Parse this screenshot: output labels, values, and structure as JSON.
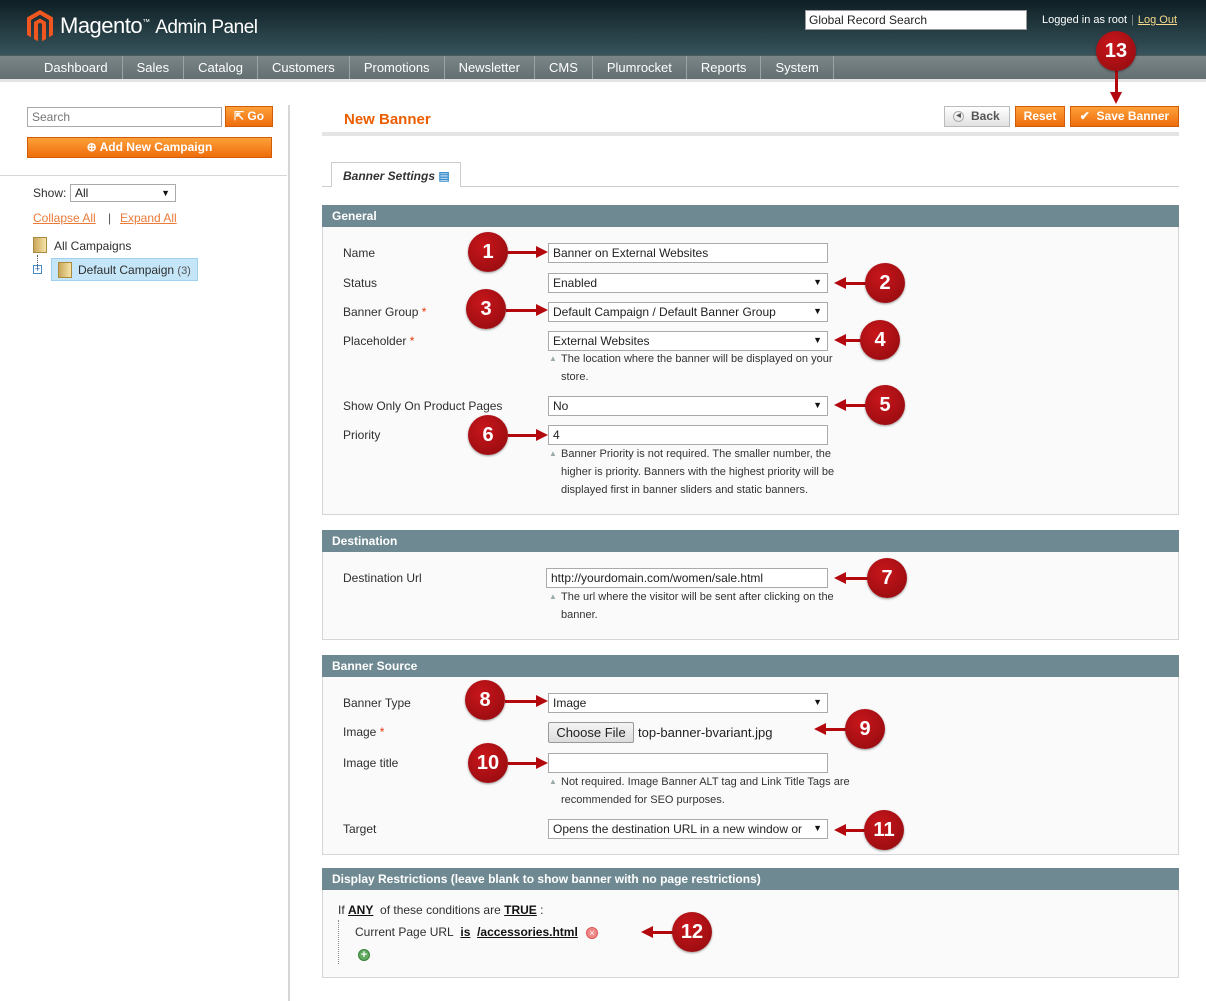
{
  "header": {
    "logo": "Magento",
    "logo_suffix": "Admin Panel",
    "global_search_placeholder": "Global Record Search",
    "logged_in": "Logged in as root",
    "logout": "Log Out"
  },
  "nav": [
    "Dashboard",
    "Sales",
    "Catalog",
    "Customers",
    "Promotions",
    "Newsletter",
    "CMS",
    "Plumrocket",
    "Reports",
    "System"
  ],
  "sidebar": {
    "search_placeholder": "Search",
    "go": "Go",
    "add_campaign": "Add New Campaign",
    "show_label": "Show:",
    "show_value": "All",
    "collapse_all": "Collapse All",
    "expand_all": "Expand All",
    "tree": {
      "root": "All Campaigns",
      "child": "Default Campaign",
      "child_count": "(3)"
    }
  },
  "page": {
    "title": "New Banner",
    "back": "Back",
    "reset": "Reset",
    "save": "Save Banner",
    "tab": "Banner Settings"
  },
  "general": {
    "title": "General",
    "name_label": "Name",
    "name_value": "Banner on External Websites",
    "status_label": "Status",
    "status_value": "Enabled",
    "group_label": "Banner Group",
    "group_value": "Default Campaign / Default Banner Group",
    "placeholder_label": "Placeholder",
    "placeholder_value": "External Websites",
    "placeholder_note": "The location where the banner will be displayed on your store.",
    "product_label": "Show Only On Product Pages",
    "product_value": "No",
    "priority_label": "Priority",
    "priority_value": "4",
    "priority_note": "Banner Priority is not required. The smaller number, the higher is priority. Banners with the highest priority will be displayed first in banner sliders and static banners."
  },
  "destination": {
    "title": "Destination",
    "url_label": "Destination Url",
    "url_value": "http://yourdomain.com/women/sale.html",
    "url_note": "The url where the visitor will be sent after clicking on the banner."
  },
  "source": {
    "title": "Banner Source",
    "type_label": "Banner Type",
    "type_value": "Image",
    "image_label": "Image",
    "choose_file": "Choose File",
    "file_name": "top-banner-bvariant.jpg",
    "image_title_label": "Image title",
    "image_title_value": "",
    "image_title_note": "Not required. Image Banner ALT tag and Link Title Tags are recommended for SEO purposes.",
    "target_label": "Target",
    "target_value": "Opens the destination URL in a new window or"
  },
  "restrictions": {
    "title": "Display Restrictions (leave blank to show banner with no page restrictions)",
    "if": "If",
    "any": "ANY",
    "of_these": "of these conditions are",
    "true": "TRUE",
    "colon": ":",
    "cond_attr": "Current Page URL",
    "cond_op": "is",
    "cond_val": "/accessories.html"
  },
  "callouts": [
    "1",
    "2",
    "3",
    "4",
    "5",
    "6",
    "7",
    "8",
    "9",
    "10",
    "11",
    "12",
    "13"
  ],
  "colors": {
    "accent": "#f18021",
    "callout": "#b3090e",
    "section_header": "#6f8992"
  }
}
